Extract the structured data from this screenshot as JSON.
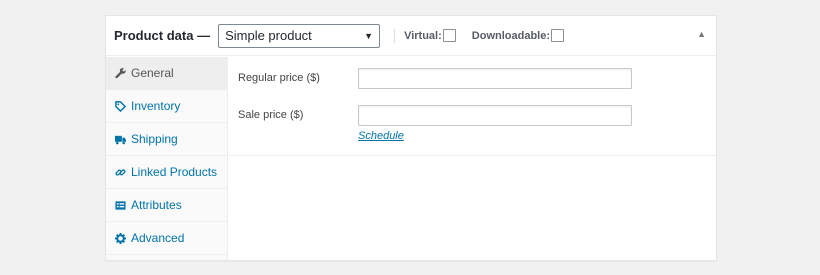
{
  "header": {
    "title": "Product data —",
    "product_type": {
      "selected": "Simple product",
      "caret_icon": "chevron-down-icon"
    },
    "options": [
      {
        "label": "Virtual:",
        "checked": false
      },
      {
        "label": "Downloadable:",
        "checked": false
      }
    ],
    "collapse_icon": "triangle-up-icon"
  },
  "tabs": [
    {
      "label": "General",
      "icon": "wrench-icon",
      "active": true
    },
    {
      "label": "Inventory",
      "icon": "tag-icon",
      "active": false
    },
    {
      "label": "Shipping",
      "icon": "truck-icon",
      "active": false
    },
    {
      "label": "Linked Products",
      "icon": "link-icon",
      "active": false
    },
    {
      "label": "Attributes",
      "icon": "list-icon",
      "active": false
    },
    {
      "label": "Advanced",
      "icon": "gear-icon",
      "active": false
    }
  ],
  "general": {
    "regular_price": {
      "label": "Regular price ($)",
      "value": "",
      "placeholder": ""
    },
    "sale_price": {
      "label": "Sale price ($)",
      "value": "",
      "placeholder": ""
    },
    "schedule_link": "Schedule"
  },
  "colors": {
    "link": "#0073aa",
    "active_tab_bg": "#eeeeee",
    "panel_bg": "#ffffff",
    "page_bg": "#f1f1f1"
  }
}
